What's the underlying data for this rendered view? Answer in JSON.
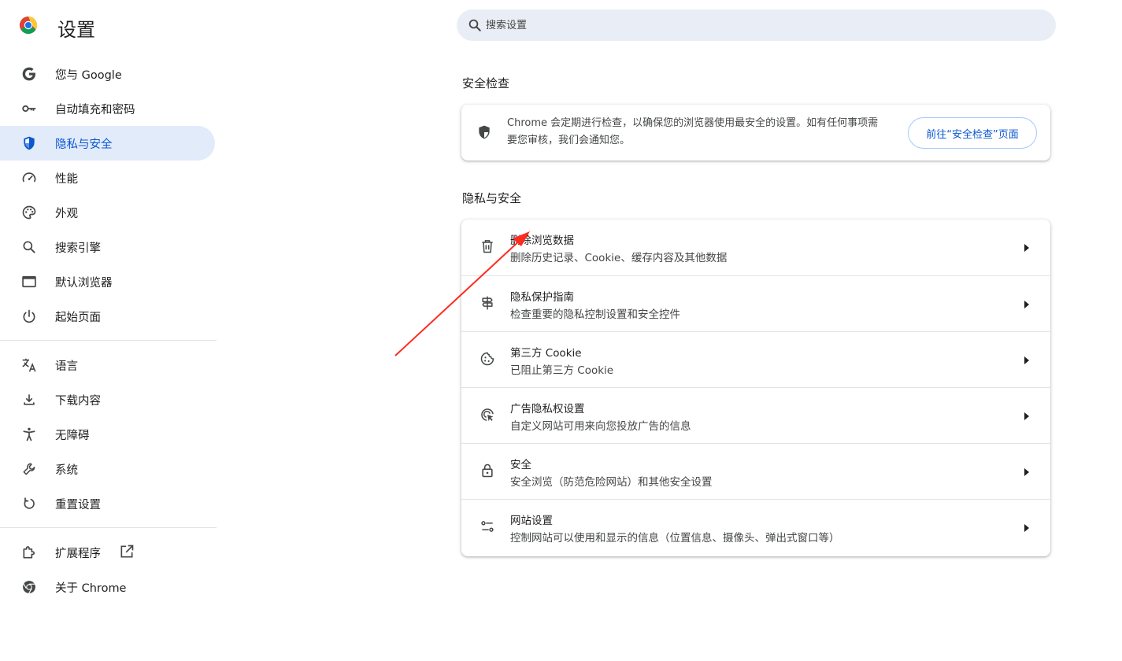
{
  "header": {
    "app_title": "设置",
    "search_placeholder": "搜索设置"
  },
  "sidebar": {
    "items": [
      {
        "label": "您与 Google",
        "icon": "google-g-icon"
      },
      {
        "label": "自动填充和密码",
        "icon": "key-icon"
      },
      {
        "label": "隐私与安全",
        "icon": "shield-icon",
        "active": true
      },
      {
        "label": "性能",
        "icon": "speedometer-icon"
      },
      {
        "label": "外观",
        "icon": "palette-icon"
      },
      {
        "label": "搜索引擎",
        "icon": "search-icon"
      },
      {
        "label": "默认浏览器",
        "icon": "browser-window-icon"
      },
      {
        "label": "起始页面",
        "icon": "power-icon"
      },
      {
        "label": "语言",
        "icon": "translate-icon"
      },
      {
        "label": "下载内容",
        "icon": "download-icon"
      },
      {
        "label": "无障碍",
        "icon": "accessibility-icon"
      },
      {
        "label": "系统",
        "icon": "wrench-icon"
      },
      {
        "label": "重置设置",
        "icon": "reset-icon"
      },
      {
        "label": "扩展程序",
        "icon": "puzzle-icon"
      },
      {
        "label": "关于 Chrome",
        "icon": "chrome-icon"
      }
    ]
  },
  "safety_check": {
    "section_title": "安全检查",
    "description": "Chrome 会定期进行检查，以确保您的浏览器使用最安全的设置。如有任何事项需要您审核，我们会通知您。",
    "button_label": "前往“安全检查”页面"
  },
  "privacy": {
    "section_title": "隐私与安全",
    "rows": [
      {
        "title": "删除浏览数据",
        "subtitle": "删除历史记录、Cookie、缓存内容及其他数据",
        "icon": "trash-icon"
      },
      {
        "title": "隐私保护指南",
        "subtitle": "检查重要的隐私控制设置和安全控件",
        "icon": "signpost-icon"
      },
      {
        "title": "第三方 Cookie",
        "subtitle": "已阻止第三方 Cookie",
        "icon": "cookie-icon"
      },
      {
        "title": "广告隐私权设置",
        "subtitle": "自定义网站可用来向您投放广告的信息",
        "icon": "ad-target-icon"
      },
      {
        "title": "安全",
        "subtitle": "安全浏览（防范危险网站）和其他安全设置",
        "icon": "lock-icon"
      },
      {
        "title": "网站设置",
        "subtitle": "控制网站可以使用和显示的信息（位置信息、摄像头、弹出式窗口等）",
        "icon": "tune-icon"
      }
    ]
  },
  "colors": {
    "accent": "#0b57d0",
    "active_bg": "#e2ebfa",
    "search_bg": "#e9eef6",
    "annotation_arrow": "#ff2a1f"
  }
}
